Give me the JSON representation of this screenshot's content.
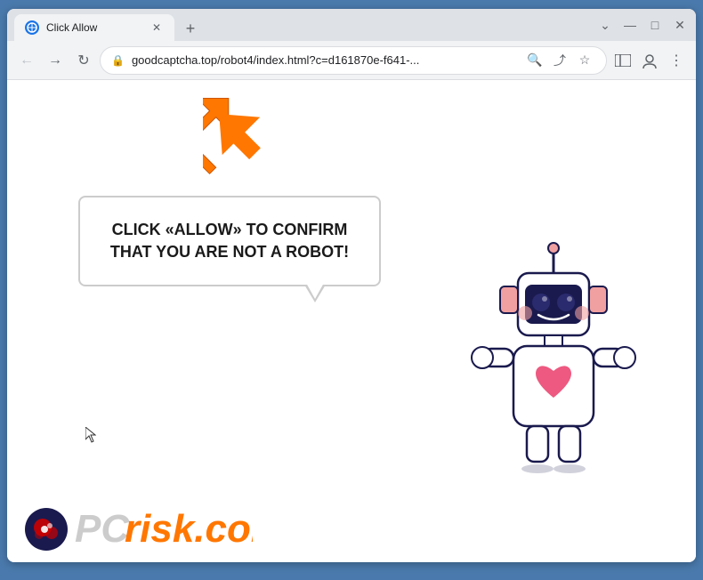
{
  "browser": {
    "tab": {
      "title": "Click Allow",
      "favicon_char": "🌐"
    },
    "new_tab_label": "+",
    "window_controls": {
      "minimize": "—",
      "maximize": "□",
      "close": "✕"
    },
    "toolbar": {
      "back_arrow": "←",
      "forward_arrow": "→",
      "refresh": "↻",
      "address": "goodcaptcha.top/robot4/index.html?c=d161870e-f641-...",
      "lock_icon": "🔒"
    }
  },
  "page": {
    "bubble_text": "CLICK «ALLOW» TO CONFIRM THAT YOU ARE NOT A ROBOT!",
    "accent_color": "#ff7700"
  },
  "pcrisk": {
    "text_gray": "PC",
    "text_orange": "risk.com"
  }
}
